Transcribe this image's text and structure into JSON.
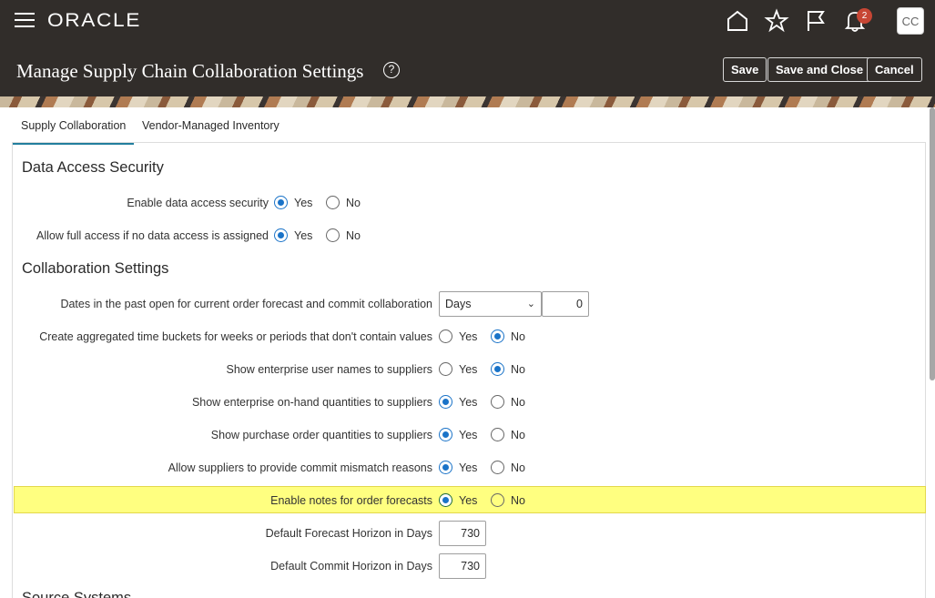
{
  "topbar": {
    "logo": "ORACLE",
    "notification_count": "2",
    "avatar_initials": "CC"
  },
  "header": {
    "title": "Manage Supply Chain Collaboration Settings",
    "help": "?",
    "save": "Save",
    "save_close": "Save and Close",
    "cancel": "Cancel"
  },
  "tabs": [
    "Supply Collaboration",
    "Vendor-Managed Inventory"
  ],
  "sections": {
    "data_access": "Data Access Security",
    "collab": "Collaboration Settings",
    "source": "Source Systems"
  },
  "radio_labels": {
    "yes": "Yes",
    "no": "No"
  },
  "data_access_rows": [
    {
      "label": "Enable data access security",
      "selected": "Yes"
    },
    {
      "label": "Allow full access if no data access is assigned",
      "selected": "Yes"
    }
  ],
  "dates_past": {
    "label": "Dates in the past open for current order forecast and commit collaboration",
    "unit": "Days",
    "value": "0"
  },
  "collab_rows": [
    {
      "label": "Create aggregated time buckets for weeks or periods that don't contain values",
      "selected": "No"
    },
    {
      "label": "Show enterprise user names to suppliers",
      "selected": "No"
    },
    {
      "label": "Show enterprise on-hand quantities to suppliers",
      "selected": "Yes"
    },
    {
      "label": "Show purchase order quantities to suppliers",
      "selected": "Yes"
    },
    {
      "label": "Allow suppliers to provide commit mismatch reasons",
      "selected": "Yes"
    },
    {
      "label": "Enable notes for order forecasts",
      "selected": "Yes"
    }
  ],
  "forecast_horizon": {
    "label": "Default Forecast Horizon in Days",
    "value": "730"
  },
  "commit_horizon": {
    "label": "Default Commit Horizon in Days",
    "value": "730"
  },
  "colors": {
    "brand_bar": "#312d2a",
    "accent": "#1a73c8",
    "highlight": "#ffff80",
    "badge": "#c74634"
  }
}
